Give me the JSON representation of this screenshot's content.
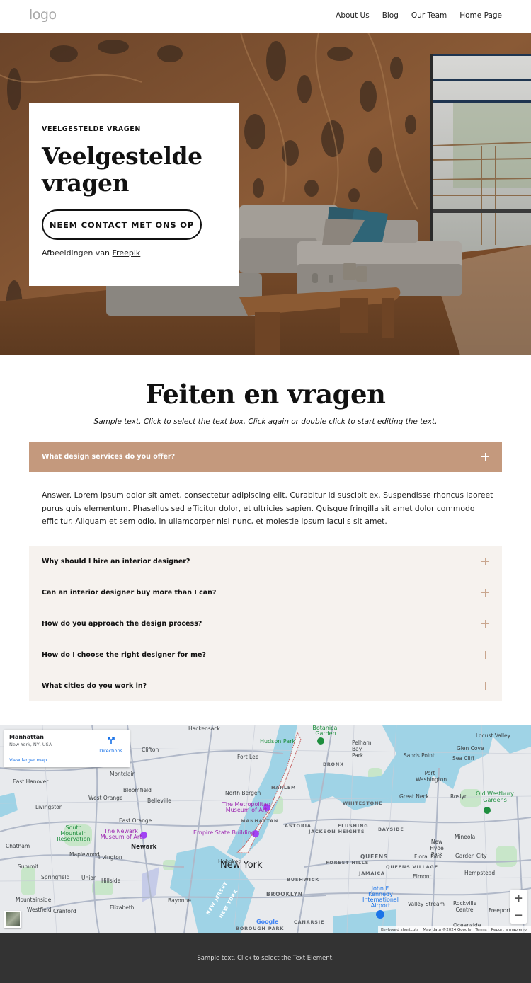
{
  "header": {
    "logo": "logo",
    "nav": [
      "About Us",
      "Blog",
      "Our Team",
      "Home Page"
    ]
  },
  "hero": {
    "eyebrow": "VEELGESTELDE VRAGEN",
    "title": "Veelgestelde vragen",
    "button": "NEEM CONTACT MET ONS OP",
    "credit_prefix": "Afbeeldingen van",
    "credit_link": "Freepik",
    "image_description": "interior-living-room-wood-wall"
  },
  "faq": {
    "title": "Feiten en vragen",
    "subtitle": "Sample text. Click to select the text box. Click again or double click to start editing the text.",
    "accent_color": "#c4997d",
    "list_bg_color": "#f6f2ee",
    "active": {
      "question": "What design services do you offer?",
      "answer": "Answer. Lorem ipsum dolor sit amet, consectetur adipiscing elit. Curabitur id suscipit ex. Suspendisse rhoncus laoreet purus quis elementum. Phasellus sed efficitur dolor, et ultricies sapien. Quisque fringilla sit amet dolor commodo efficitur. Aliquam et sem odio. In ullamcorper nisi nunc, et molestie ipsum iaculis sit amet."
    },
    "items": [
      {
        "question": "Why should I hire an interior designer?"
      },
      {
        "question": "Can an interior designer buy more than I can?"
      },
      {
        "question": "How do you approach the design process?"
      },
      {
        "question": "How do I choose the right designer for me?"
      },
      {
        "question": "What cities do you work in?"
      }
    ]
  },
  "map": {
    "card": {
      "place": "Manhattan",
      "address": "New York, NY, USA",
      "directions": "Directions",
      "larger_map": "View larger map"
    },
    "labels": {
      "new_york": "New York",
      "manhattan": "MANHATTAN",
      "brooklyn": "BROOKLYN",
      "queens": "QUEENS",
      "harlem": "HARLEM",
      "bronx": "BRONX",
      "astoria": "ASTORIA",
      "bushwick": "BUSHWICK",
      "flushing": "FLUSHING",
      "bayside": "BAYSIDE",
      "whitestone": "WHITESTONE",
      "jackson_heights": "JACKSON HEIGHTS",
      "forest_hills": "FOREST HILLS",
      "queens_village": "QUEENS VILLAGE",
      "jamaica": "JAMAICA",
      "canarsie": "CANARSIE",
      "borough_park": "BOROUGH PARK",
      "hoboken": "Hoboken",
      "newark": "Newark",
      "fort_lee": "Fort Lee",
      "north_bergen": "North Bergen",
      "hackensack": "Hackensack",
      "clifton": "Clifton",
      "montclair": "Montclair",
      "bloomfield": "Bloomfield",
      "belleville": "Belleville",
      "west_orange": "West Orange",
      "east_orange": "East Orange",
      "livingston": "Livingston",
      "east_hanover": "East Hanover",
      "chatham": "Chatham",
      "summit": "Summit",
      "maplewood": "Maplewood",
      "irvington": "Irvington",
      "springfield": "Springfield",
      "union": "Union",
      "hillside": "Hillside",
      "mountainside": "Mountainside",
      "westfield": "Westfield",
      "cranford": "Cranford",
      "elizabeth": "Elizabeth",
      "bayonne": "Bayonne",
      "new_jersey": "NEW JERSEY",
      "new_york_state": "NEW YORK",
      "pelham_bay_park": "Pelham Bay Park",
      "sands_point": "Sands Point",
      "port_washington": "Port Washington",
      "great_neck": "Great Neck",
      "glen_cove": "Glen Cove",
      "sea_cliff": "Sea Cliff",
      "locust_valley": "Locust Valley",
      "roslyn": "Roslyn",
      "old_westbury": "Old Westbury Gardens",
      "mineola": "Mineola",
      "new_hyde_park": "New Hyde Park",
      "floral_park": "Floral Park",
      "garden_city": "Garden City",
      "hempstead": "Hempstead",
      "elmont": "Elmont",
      "valley_stream": "Valley Stream",
      "rockville_centre": "Rockville Centre",
      "freeport": "Freeport",
      "oceanside": "Oceanside",
      "jfk": "John F. Kennedy International Airport",
      "met_museum": "The Metropolitan Museum of Art",
      "empire_state": "Empire State Building",
      "newark_museum": "The Newark Museum of Art",
      "hudson_park": "Hudson Park",
      "south_mountain": "South Mountain Reservation",
      "botanical_garden": "Botanical Garden"
    },
    "zoom_in": "+",
    "zoom_out": "−",
    "google": "Google",
    "attribution": {
      "shortcuts": "Keyboard shortcuts",
      "data": "Map data ©2024 Google",
      "terms": "Terms",
      "report": "Report a map error"
    }
  },
  "footer": {
    "text": "Sample text. Click to select the Text Element."
  }
}
